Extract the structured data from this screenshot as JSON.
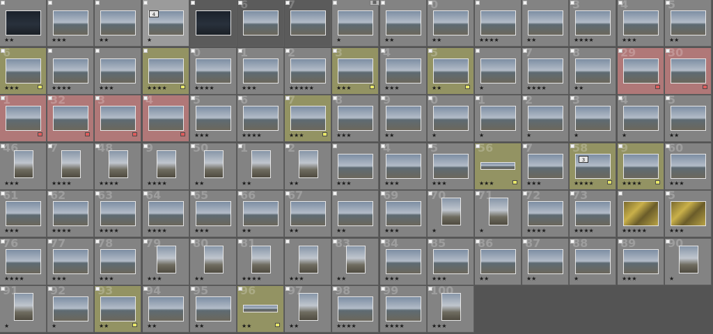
{
  "colors": {
    "cell": "#838383",
    "selected": "#9b9b9b",
    "olive": "#939363",
    "red": "#b07878",
    "dark_cell": "#5b5b5b",
    "background": "#545454",
    "label_yellow": "#e8e868",
    "label_red": "#e05c5c"
  },
  "grid_icon": "grid-icon",
  "badges": {
    "stack_a": "4",
    "stack_b": "3"
  },
  "rows": [
    [
      {
        "num": "",
        "stars": "★★",
        "thumb": "night"
      },
      {
        "num": "",
        "stars": "★★★"
      },
      {
        "num": "",
        "stars": "★★"
      },
      {
        "num": "",
        "stars": "★",
        "bg": "sel"
      },
      {
        "num": "",
        "stars": "",
        "bg": "dark",
        "thumb": "night"
      },
      {
        "num": "6",
        "stars": "",
        "bg": "dark"
      },
      {
        "num": "7",
        "stars": "",
        "bg": "dark"
      },
      {
        "num": "",
        "stars": "★"
      },
      {
        "num": "",
        "stars": "★★"
      },
      {
        "num": "0",
        "stars": "★★"
      },
      {
        "num": "",
        "stars": "★★★★"
      },
      {
        "num": "",
        "stars": "★★"
      },
      {
        "num": "3",
        "stars": "★★★★"
      },
      {
        "num": "4",
        "stars": "★★★"
      },
      {
        "num": "5",
        "stars": "★★"
      }
    ],
    [
      {
        "num": "6",
        "stars": "★★★",
        "bg": "olive",
        "label": "yellow"
      },
      {
        "num": "",
        "stars": "★★★★"
      },
      {
        "num": "",
        "stars": "★★★"
      },
      {
        "num": "",
        "stars": "★★★★",
        "bg": "olive",
        "label": "yellow"
      },
      {
        "num": "0",
        "stars": "★★★★"
      },
      {
        "num": "1",
        "stars": "★★★"
      },
      {
        "num": "2",
        "stars": "★★★★★"
      },
      {
        "num": "3",
        "stars": "★★★",
        "bg": "olive",
        "label": "yellow"
      },
      {
        "num": "4",
        "stars": "★★★"
      },
      {
        "num": "5",
        "stars": "★★",
        "bg": "olive",
        "label": "yellow"
      },
      {
        "num": "",
        "stars": "★"
      },
      {
        "num": "7",
        "stars": "★★★★"
      },
      {
        "num": "8",
        "stars": "★★"
      },
      {
        "num": "29",
        "stars": "",
        "bg": "red",
        "label": "red"
      },
      {
        "num": "30",
        "stars": "",
        "bg": "red",
        "label": "red"
      }
    ],
    [
      {
        "num": "1",
        "stars": "",
        "bg": "red",
        "label": "red"
      },
      {
        "num": "32",
        "stars": "",
        "bg": "red",
        "label": "red"
      },
      {
        "num": "3",
        "stars": "",
        "bg": "red",
        "label": "red"
      },
      {
        "num": "4",
        "stars": "",
        "bg": "red",
        "label": "red"
      },
      {
        "num": "5",
        "stars": "★★★"
      },
      {
        "num": "6",
        "stars": "★★★★"
      },
      {
        "num": "7",
        "stars": "★★★",
        "bg": "olive",
        "label": "yellow"
      },
      {
        "num": "8",
        "stars": "★★★"
      },
      {
        "num": "9",
        "stars": "★★"
      },
      {
        "num": "0",
        "stars": "★"
      },
      {
        "num": "1",
        "stars": "★"
      },
      {
        "num": "2",
        "stars": "★"
      },
      {
        "num": "3",
        "stars": "★"
      },
      {
        "num": "4",
        "stars": "★"
      },
      {
        "num": "5",
        "stars": "★★"
      }
    ],
    [
      {
        "num": "46",
        "stars": "★★★",
        "v": true
      },
      {
        "num": "7",
        "stars": "★★★★",
        "v": true
      },
      {
        "num": "48",
        "stars": "★★★★",
        "v": true
      },
      {
        "num": "9",
        "stars": "★★★★",
        "v": true
      },
      {
        "num": "50",
        "stars": "★★",
        "v": true
      },
      {
        "num": "1",
        "stars": "★★",
        "v": true
      },
      {
        "num": "2",
        "stars": "★★",
        "v": true
      },
      {
        "num": "",
        "stars": "★★★"
      },
      {
        "num": "4",
        "stars": "★★★"
      },
      {
        "num": "5",
        "stars": "★★★"
      },
      {
        "num": "56",
        "stars": "★★★",
        "bg": "olive",
        "label": "yellow",
        "small": true
      },
      {
        "num": "7",
        "stars": "★★★"
      },
      {
        "num": "58",
        "stars": "★★★★",
        "bg": "olive",
        "label": "yellow"
      },
      {
        "num": "9",
        "stars": "★★★★",
        "bg": "olive",
        "label": "yellow"
      },
      {
        "num": "60",
        "stars": "★★★"
      }
    ],
    [
      {
        "num": "61",
        "stars": "★★★"
      },
      {
        "num": "62",
        "stars": "★★★★"
      },
      {
        "num": "63",
        "stars": "★★★★"
      },
      {
        "num": "64",
        "stars": "★★★★"
      },
      {
        "num": "65",
        "stars": "★★★"
      },
      {
        "num": "66",
        "stars": "★★"
      },
      {
        "num": "67",
        "stars": "★★"
      },
      {
        "num": "",
        "stars": "★★"
      },
      {
        "num": "69",
        "stars": "★★★"
      },
      {
        "num": "70",
        "stars": "★",
        "v": true
      },
      {
        "num": "71",
        "stars": "★",
        "v": true
      },
      {
        "num": "72",
        "stars": "★★★★"
      },
      {
        "num": "73",
        "stars": "★★★★"
      },
      {
        "num": "",
        "stars": "★★★★★",
        "thumb": "moss"
      },
      {
        "num": "5",
        "stars": "★★★",
        "thumb": "moss"
      }
    ],
    [
      {
        "num": "76",
        "stars": "★★★★"
      },
      {
        "num": "77",
        "stars": "★★★"
      },
      {
        "num": "78",
        "stars": "★★★"
      },
      {
        "num": "79",
        "stars": "★★★",
        "v": true
      },
      {
        "num": "80",
        "stars": "★★",
        "v": true
      },
      {
        "num": "81",
        "stars": "★★★★",
        "v": true
      },
      {
        "num": "",
        "stars": "★★★",
        "v": true
      },
      {
        "num": "83",
        "stars": "★★",
        "v": true
      },
      {
        "num": "84",
        "stars": "★★★"
      },
      {
        "num": "85",
        "stars": "★★★"
      },
      {
        "num": "86",
        "stars": "★★"
      },
      {
        "num": "87",
        "stars": "★★"
      },
      {
        "num": "88",
        "stars": "★"
      },
      {
        "num": "89",
        "stars": "★★★"
      },
      {
        "num": "90",
        "stars": "★",
        "v": true
      }
    ],
    [
      {
        "num": "91",
        "stars": "★",
        "v": true
      },
      {
        "num": "92",
        "stars": "★"
      },
      {
        "num": "93",
        "stars": "★★",
        "bg": "olive",
        "label": "yellow"
      },
      {
        "num": "94",
        "stars": "★★"
      },
      {
        "num": "95",
        "stars": "★★"
      },
      {
        "num": "96",
        "stars": "★★",
        "bg": "olive",
        "label": "yellow",
        "small": true
      },
      {
        "num": "97",
        "stars": "★★",
        "v": true
      },
      {
        "num": "98",
        "stars": "★★★★"
      },
      {
        "num": "99",
        "stars": "★★★★"
      },
      {
        "num": "100",
        "stars": "★★★",
        "v": true
      }
    ]
  ]
}
